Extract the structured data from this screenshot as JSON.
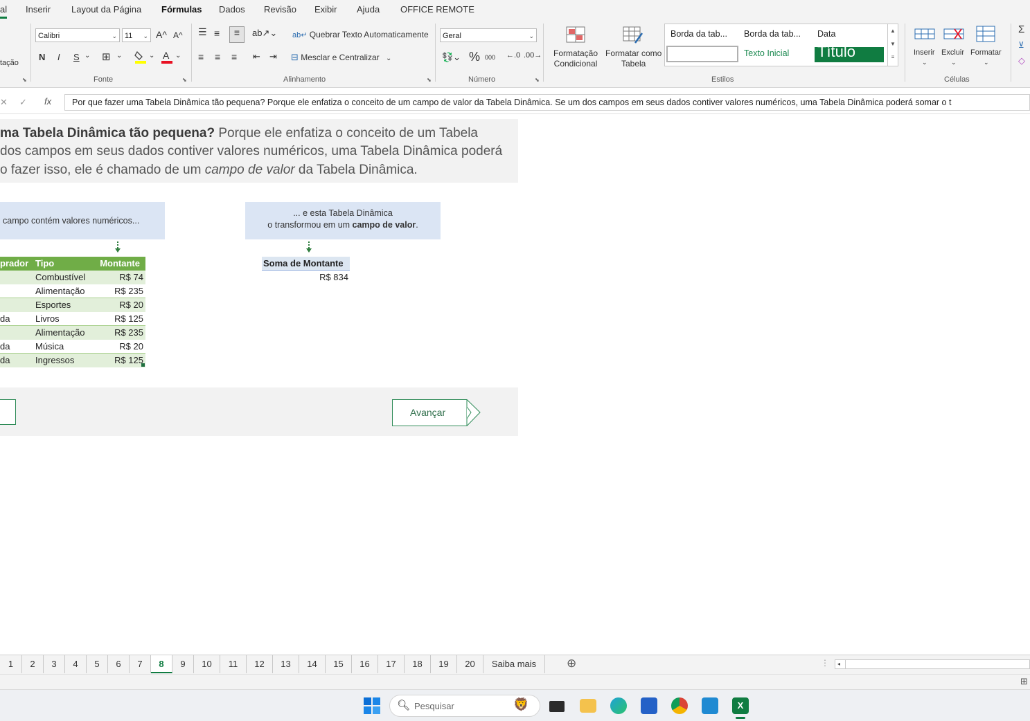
{
  "menu": {
    "items": [
      {
        "label": "al",
        "active": false
      },
      {
        "label": "Inserir",
        "active": false
      },
      {
        "label": "Layout da Página",
        "active": false
      },
      {
        "label": "Fórmulas",
        "active": true
      },
      {
        "label": "Dados",
        "active": false
      },
      {
        "label": "Revisão",
        "active": false
      },
      {
        "label": "Exibir",
        "active": false
      },
      {
        "label": "Ajuda",
        "active": false
      },
      {
        "label": "OFFICE REMOTE",
        "active": false
      }
    ]
  },
  "ribbon": {
    "clipboard_fragment": "tação",
    "font": {
      "name": "Calibri",
      "size": "11",
      "grow": "A^",
      "shrink": "A^",
      "bold": "N",
      "italic": "I",
      "underline": "S",
      "label": "Fonte"
    },
    "alignment": {
      "wrap_text": "Quebrar Texto Automaticamente",
      "merge_center": "Mesclar e Centralizar",
      "label": "Alinhamento"
    },
    "number": {
      "format": "Geral",
      "percent": "%",
      "thousands": "000",
      "label": "Número"
    },
    "styles": {
      "conditional_formatting": [
        "Formatação",
        "Condicional"
      ],
      "format_as_table": [
        "Formatar como",
        "Tabela"
      ],
      "cell_styles": [
        "Borda da tab...",
        "Borda da tab...",
        "Data",
        "",
        "Texto Inicial",
        "Título"
      ],
      "label": "Estilos"
    },
    "cells": {
      "insert": "Inserir",
      "delete": "Excluir",
      "format": "Formatar",
      "label": "Células"
    }
  },
  "formula_bar": {
    "fx": "fx",
    "content": "Por que fazer uma Tabela Dinâmica tão pequena? Porque ele enfatiza o conceito de um campo de valor da Tabela Dinâmica. Se um dos campos em seus dados contiver valores numéricos, uma Tabela Dinâmica poderá somar o t"
  },
  "sheet": {
    "intro": {
      "line1_bold": "ma Tabela Dinâmica tão pequena?",
      "line1_rest": " Porque ele enfatiza o conceito de um Tabela",
      "line2": " dos campos em seus dados contiver valores numéricos, uma Tabela Dinâmica poderá",
      "line3_pre": "o fazer isso, ele é chamado de um ",
      "line3_italic": "campo de valor",
      "line3_post": " da Tabela Dinâmica."
    },
    "callout_left": "campo contém valores numéricos...",
    "callout_right_line1": "... e esta Tabela Dinâmica",
    "callout_right_pre": "o transformou em um ",
    "callout_right_bold": "campo de valor",
    "callout_right_post": ".",
    "table": {
      "headers": [
        "prador",
        "Tipo",
        "Montante"
      ],
      "rows": [
        [
          "",
          "Combustível",
          "R$ 74"
        ],
        [
          "",
          "Alimentação",
          "R$ 235"
        ],
        [
          "",
          "Esportes",
          "R$ 20"
        ],
        [
          "da",
          "Livros",
          "R$ 125"
        ],
        [
          "",
          "Alimentação",
          "R$ 235"
        ],
        [
          "da",
          "Música",
          "R$ 20"
        ],
        [
          "da",
          "Ingressos",
          "R$ 125"
        ]
      ]
    },
    "pivot": {
      "header": "Soma de Montante",
      "value": "R$ 834"
    },
    "next_button": "Avançar"
  },
  "sheet_tabs": {
    "tabs": [
      "1",
      "2",
      "3",
      "4",
      "5",
      "6",
      "7",
      "8",
      "9",
      "10",
      "11",
      "12",
      "13",
      "14",
      "15",
      "16",
      "17",
      "18",
      "19",
      "20",
      "Saiba mais"
    ],
    "active": "8",
    "add": "⊕"
  },
  "taskbar": {
    "search_placeholder": "Pesquisar"
  },
  "colors": {
    "accent_green": "#107c41",
    "table_header_green": "#70ad47",
    "table_band": "#e2efda",
    "callout_blue": "#dbe5f4",
    "band_gray": "#f2f2f2"
  }
}
